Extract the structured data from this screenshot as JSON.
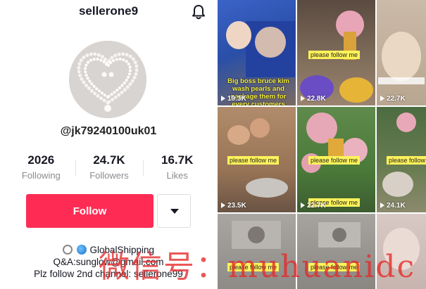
{
  "profile": {
    "username": "sellerone9",
    "handle": "@jk79240100uk01",
    "stats": [
      {
        "value": "2026",
        "label": "Following"
      },
      {
        "value": "24.7K",
        "label": "Followers"
      },
      {
        "value": "16.7K",
        "label": "Likes"
      }
    ],
    "follow_label": "Follow",
    "bio": {
      "line1": "GlobalShipping",
      "line2": "Q&A:sunglow@gmail.com",
      "line3": "Plz follow 2nd channel: sellerone99"
    },
    "icons": {
      "bell": "bell-icon",
      "more": "chevron-down-icon"
    }
  },
  "grid": {
    "videos": [
      {
        "views": "19.3K",
        "caption": "Big boss bruce kim wash pearls and package them for every customers carefully"
      },
      {
        "views": "22.8K",
        "tag": "please follow me"
      },
      {
        "views": "22.7K"
      },
      {
        "views": "23.5K",
        "tag": "please follow me"
      },
      {
        "views": "22.7K",
        "tag": "please follow me",
        "tag2": "please follow me"
      },
      {
        "views": "24.1K",
        "tag": "please follow me"
      },
      {
        "tag": "please follow me"
      },
      {
        "tag": "please follow me"
      },
      {}
    ]
  },
  "watermark": "微信号：muhuanidc",
  "colors": {
    "accent": "#fe2c55",
    "tag_bg": "#fff35a",
    "watermark": "#e62828"
  }
}
